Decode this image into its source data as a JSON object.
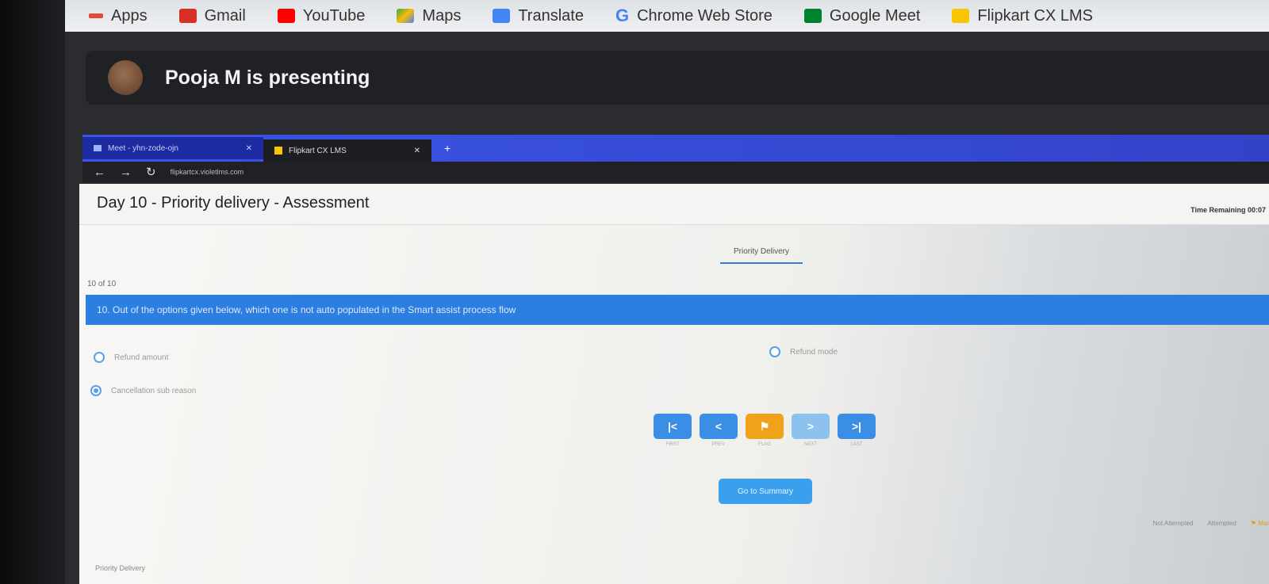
{
  "bookmarks": [
    {
      "label": "Apps",
      "icon": "apps-grid-icon",
      "color": "#e8453c"
    },
    {
      "label": "Gmail",
      "icon": "gmail-icon",
      "color": "#d93025"
    },
    {
      "label": "YouTube",
      "icon": "youtube-icon",
      "color": "#ff0000"
    },
    {
      "label": "Maps",
      "icon": "maps-icon",
      "color": "#34a853"
    },
    {
      "label": "Translate",
      "icon": "translate-icon",
      "color": "#4285f4"
    },
    {
      "label": "Chrome Web Store",
      "icon": "chrome-web-store-icon",
      "color": "#4285f4"
    },
    {
      "label": "Google Meet",
      "icon": "google-meet-icon",
      "color": "#00832d"
    },
    {
      "label": "Flipkart CX LMS",
      "icon": "flipkart-icon",
      "color": "#f7c600"
    }
  ],
  "meet": {
    "presenting_text": "Pooja M is presenting"
  },
  "inner_browser": {
    "tabs": [
      {
        "label": "Meet - yhn-zode-ojn",
        "icon": "meet-tab-icon"
      },
      {
        "label": "Flipkart CX LMS",
        "icon": "flipkart-tab-icon"
      }
    ],
    "new_tab": "+",
    "url": "flipkartcx.violetlms.com"
  },
  "assessment": {
    "title": "Day 10 - Priority delivery - Assessment",
    "timer": "Time Remaining 00:07",
    "section_tab": "Priority Delivery",
    "progress": "10 of 10",
    "question": "10. Out of the options given below, which one is not auto populated in the Smart assist process flow",
    "options": [
      {
        "label": "Refund amount",
        "checked": false
      },
      {
        "label": "Refund mode",
        "checked": false
      },
      {
        "label": "Cancellation sub reason",
        "checked": true
      }
    ],
    "nav": [
      {
        "symbol": "|<",
        "label": "FIRST",
        "style": "blue"
      },
      {
        "symbol": "<",
        "label": "PREV",
        "style": "blue"
      },
      {
        "symbol": "⚑",
        "label": "FLAG",
        "style": "orange"
      },
      {
        "symbol": ">",
        "label": "NEXT",
        "style": "light"
      },
      {
        "symbol": ">|",
        "label": "LAST",
        "style": "blue"
      }
    ],
    "summary_button": "Go to Summary",
    "legend": [
      "Not Attempted",
      "Attempted",
      "Mar"
    ],
    "footer_link": "Priority Delivery"
  }
}
